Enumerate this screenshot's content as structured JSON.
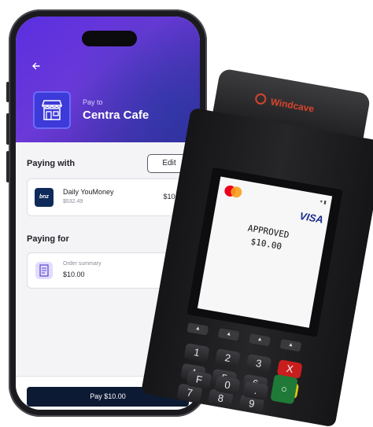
{
  "app": {
    "back_icon": "arrow-left-icon",
    "pay_to_label": "Pay to",
    "merchant_name": "Centra Cafe",
    "merchant_icon": "storefront-icon"
  },
  "paying_with": {
    "title": "Paying with",
    "edit_label": "Edit",
    "account": {
      "bank_logo_text": "bnz",
      "name": "Daily YouMoney",
      "balance": "$532.49",
      "amount": "$10.00"
    }
  },
  "paying_for": {
    "title": "Paying for",
    "summary_label": "Order summary",
    "summary_amount": "$10.00",
    "summary_icon": "receipt-icon"
  },
  "footer": {
    "pay_label": "Pay $10.00"
  },
  "terminal": {
    "brand": "Windcave",
    "status": "APPROVED",
    "amount": "$10.00",
    "card_brand": "VISA",
    "keypad": [
      "1",
      "2",
      "3",
      "X",
      "4",
      "5",
      "6",
      "<",
      "7",
      "8",
      "9",
      "F",
      "0",
      "."
    ],
    "colors": {
      "accent": "#5a2fe0",
      "pay_button": "#0d1a34",
      "brand": "#d9442a"
    }
  }
}
